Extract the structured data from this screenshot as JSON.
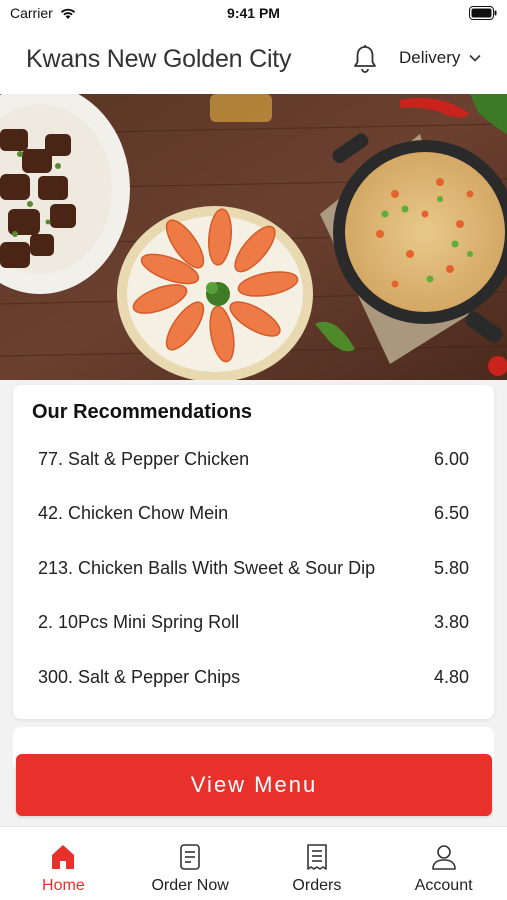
{
  "status_bar": {
    "carrier": "Carrier",
    "time": "9:41 PM"
  },
  "header": {
    "title": "Kwans New Golden City",
    "bell_icon": "bell-icon",
    "delivery_mode": "Delivery"
  },
  "recommendations": {
    "title": "Our Recommendations",
    "items": [
      {
        "name": "77. Salt & Pepper Chicken",
        "price": "6.00"
      },
      {
        "name": "42. Chicken Chow Mein",
        "price": "6.50"
      },
      {
        "name": "213. Chicken Balls With Sweet & Sour Dip",
        "price": "5.80"
      },
      {
        "name": "2. 10Pcs Mini Spring Roll",
        "price": "3.80"
      },
      {
        "name": "300. Salt & Pepper Chips",
        "price": "4.80"
      }
    ]
  },
  "view_menu": {
    "label": "View Menu"
  },
  "bottom_nav": {
    "items": [
      {
        "label": "Home",
        "icon": "home-icon",
        "active": true
      },
      {
        "label": "Order Now",
        "icon": "order-now-icon",
        "active": false
      },
      {
        "label": "Orders",
        "icon": "receipt-icon",
        "active": false
      },
      {
        "label": "Account",
        "icon": "user-icon",
        "active": false
      }
    ]
  },
  "colors": {
    "accent": "#e9312c",
    "background": "#f2f2f2"
  }
}
